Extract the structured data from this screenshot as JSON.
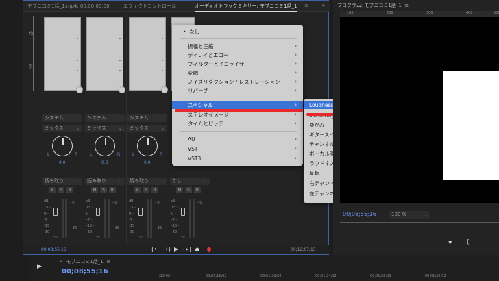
{
  "mixer": {
    "tabs": [
      "モブニコミ1話_1.mp4: 00;00;00;00",
      "エフェクトコントロール",
      "オーディオトラックミキサー: モブニコミ1話_1",
      "≡",
      "»"
    ],
    "fx_label": "fx",
    "send_label": "⅀",
    "channels": [
      {
        "input": "システム...",
        "mode": "ミックス",
        "pan": "0.0",
        "auto": "読み取り",
        "m": "M",
        "s": "S",
        "r": "R",
        "db_scale": [
          "dB",
          "15 -",
          "0 -",
          "-7 -",
          "-15 -",
          "-30 -"
        ],
        "peak": "-∞",
        "right_scale": "- 0",
        "right_low": "-36"
      },
      {
        "input": "システム...",
        "mode": "ミックス",
        "pan": "0.0",
        "auto": "読み取り",
        "m": "M",
        "s": "S",
        "r": "R",
        "db_scale": [
          "dB",
          "15 -",
          "0 -",
          "-7 -",
          "-15 -",
          "-30 -"
        ],
        "peak": "-∞",
        "right_scale": "- 0",
        "right_low": "-36"
      },
      {
        "input": "システム...",
        "mode": "ミックス",
        "pan": "0.0",
        "auto": "読み取り",
        "m": "M",
        "s": "S",
        "r": "R",
        "db_scale": [
          "dB",
          "15 -",
          "0 -",
          "-7 -",
          "-15 -",
          "-30 -"
        ],
        "peak": "-∞",
        "right_scale": "- 0",
        "right_low": "-36"
      },
      {
        "auto": "なし",
        "m": "M",
        "s": "S",
        "r": "R",
        "db_scale": [
          "dB",
          "15 -",
          "0 -",
          "-7 -",
          "-15 -",
          "-30 -"
        ],
        "peak": "-∞",
        "right_scale": "- 0"
      }
    ],
    "pan_l": "L",
    "pan_r": "R",
    "left_tc": "00;08;55;16",
    "right_tc": "00;12;07;13",
    "transport": [
      "{←",
      "→}",
      "▶",
      "{▸}",
      "⏏"
    ]
  },
  "menu": {
    "items": [
      {
        "label": "なし",
        "bullet": "•"
      },
      {
        "label": "振幅と圧縮",
        "arrow": "›"
      },
      {
        "label": "ディレイとエコー",
        "arrow": "›"
      },
      {
        "label": "フィルターとイコライザ",
        "arrow": "›"
      },
      {
        "label": "変調",
        "arrow": "›"
      },
      {
        "label": "ノイズリダクション / レストレーション",
        "arrow": "›"
      },
      {
        "label": "リバーブ",
        "arrow": "›"
      },
      {
        "label": "スペシャル",
        "arrow": "›",
        "highlight": true
      },
      {
        "label": "ステレオイメージ",
        "arrow": "›"
      },
      {
        "label": "タイムとピッチ",
        "arrow": "›"
      },
      {
        "label": "AU",
        "arrow": "›"
      },
      {
        "label": "VST",
        "arrow": "›"
      },
      {
        "label": "VST3",
        "arrow": "›"
      }
    ],
    "submenu": [
      "Loudness Radar",
      "Mastering",
      "ゆがみ",
      "ギタースイート",
      "チャンネルの入れ替え",
      "ボーカル強調",
      "ラウドネスメーター",
      "反転",
      "右チャンネルを左チャンネルに振る",
      "左チャンネルを右チャンネルに振る"
    ]
  },
  "program": {
    "title": "プログラム: モブニコミ1話_1",
    "menu_icon": "≡",
    "ruler": [
      "100",
      "200",
      "300",
      "400",
      "500"
    ],
    "timecode": "00;08;55;16",
    "zoom": "100 %"
  },
  "timeline": {
    "close": "×",
    "name": "モブニコミ1話_1",
    "menu_icon": "≡",
    "timecode": "00;08;55;16",
    "ticks": [
      ";12;02",
      "00;01;16;02",
      "00;01;20;02",
      "00;01;24;02",
      "00;01;28;02",
      "00;01;32;02"
    ]
  },
  "colors": {
    "accent": "#3a73d6",
    "underline": "#e82a2a",
    "timecode": "#6b97f2"
  }
}
